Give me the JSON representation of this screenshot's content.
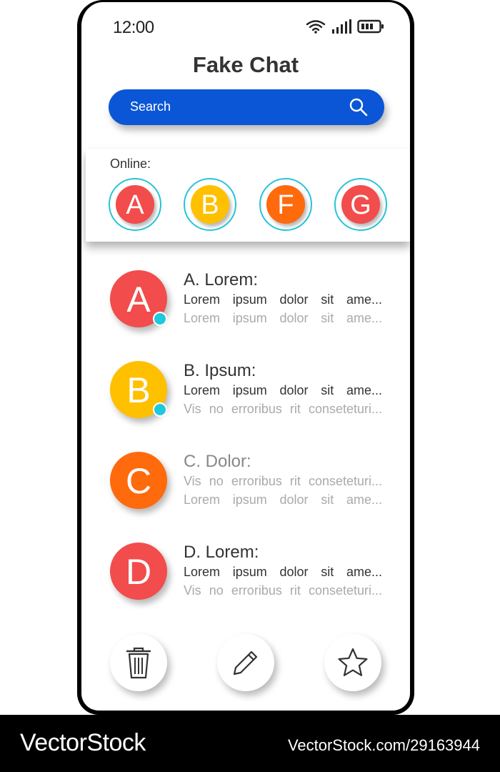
{
  "status_bar": {
    "time": "12:00"
  },
  "header": {
    "title": "Fake Chat"
  },
  "search": {
    "placeholder": "Search"
  },
  "online": {
    "label": "Online:",
    "users": [
      {
        "initial": "A",
        "color": "#f24c4c"
      },
      {
        "initial": "B",
        "color": "#ffc000"
      },
      {
        "initial": "F",
        "color": "#ff6a0d"
      },
      {
        "initial": "G",
        "color": "#f24c4c"
      }
    ]
  },
  "chats": [
    {
      "initial": "A",
      "color": "#f24c4c",
      "name": "A. Lorem:",
      "line1": "Lorem ipsum dolor sit ame...",
      "line2": "Lorem ipsum dolor sit ame...",
      "online": true,
      "unread": true
    },
    {
      "initial": "B",
      "color": "#ffc000",
      "name": "B. Ipsum:",
      "line1": "Lorem ipsum dolor sit ame...",
      "line2": "Vis no erroribus rit conseteturi...",
      "online": true,
      "unread": true
    },
    {
      "initial": "C",
      "color": "#ff6a0d",
      "name": "C. Dolor:",
      "line1": "Vis no erroribus rit conseteturi...",
      "line2": "Lorem ipsum dolor sit ame...",
      "online": false,
      "unread": false
    },
    {
      "initial": "D",
      "color": "#f24c4c",
      "name": "D. Lorem:",
      "line1": "Lorem ipsum dolor sit ame...",
      "line2": "Vis no erroribus rit conseteturi...",
      "online": false,
      "unread": true
    }
  ],
  "actions": [
    {
      "icon": "trash-icon"
    },
    {
      "icon": "pencil-icon"
    },
    {
      "icon": "star-icon"
    }
  ],
  "colors": {
    "accent": "#0b56d6",
    "online_ring": "#27c4d6",
    "presence": "#1fc8dc"
  },
  "footer": {
    "brand": "VectorStock",
    "url": "VectorStock.com/29163944"
  }
}
